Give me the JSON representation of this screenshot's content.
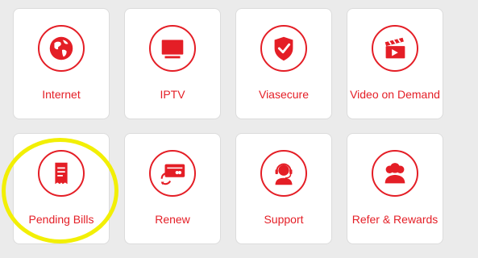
{
  "accent_color": "#e41e26",
  "highlight_color": "#f2ef05",
  "tiles": [
    {
      "label": "Internet",
      "icon": "globe-icon"
    },
    {
      "label": "IPTV",
      "icon": "tv-icon"
    },
    {
      "label": "Viasecure",
      "icon": "shield-check-icon"
    },
    {
      "label": "Video on Demand",
      "icon": "clapperboard-icon"
    },
    {
      "label": "Pending Bills",
      "icon": "receipt-icon"
    },
    {
      "label": "Renew",
      "icon": "card-renew-icon"
    },
    {
      "label": "Support",
      "icon": "headset-agent-icon"
    },
    {
      "label": "Refer & Rewards",
      "icon": "user-group-icon"
    }
  ]
}
